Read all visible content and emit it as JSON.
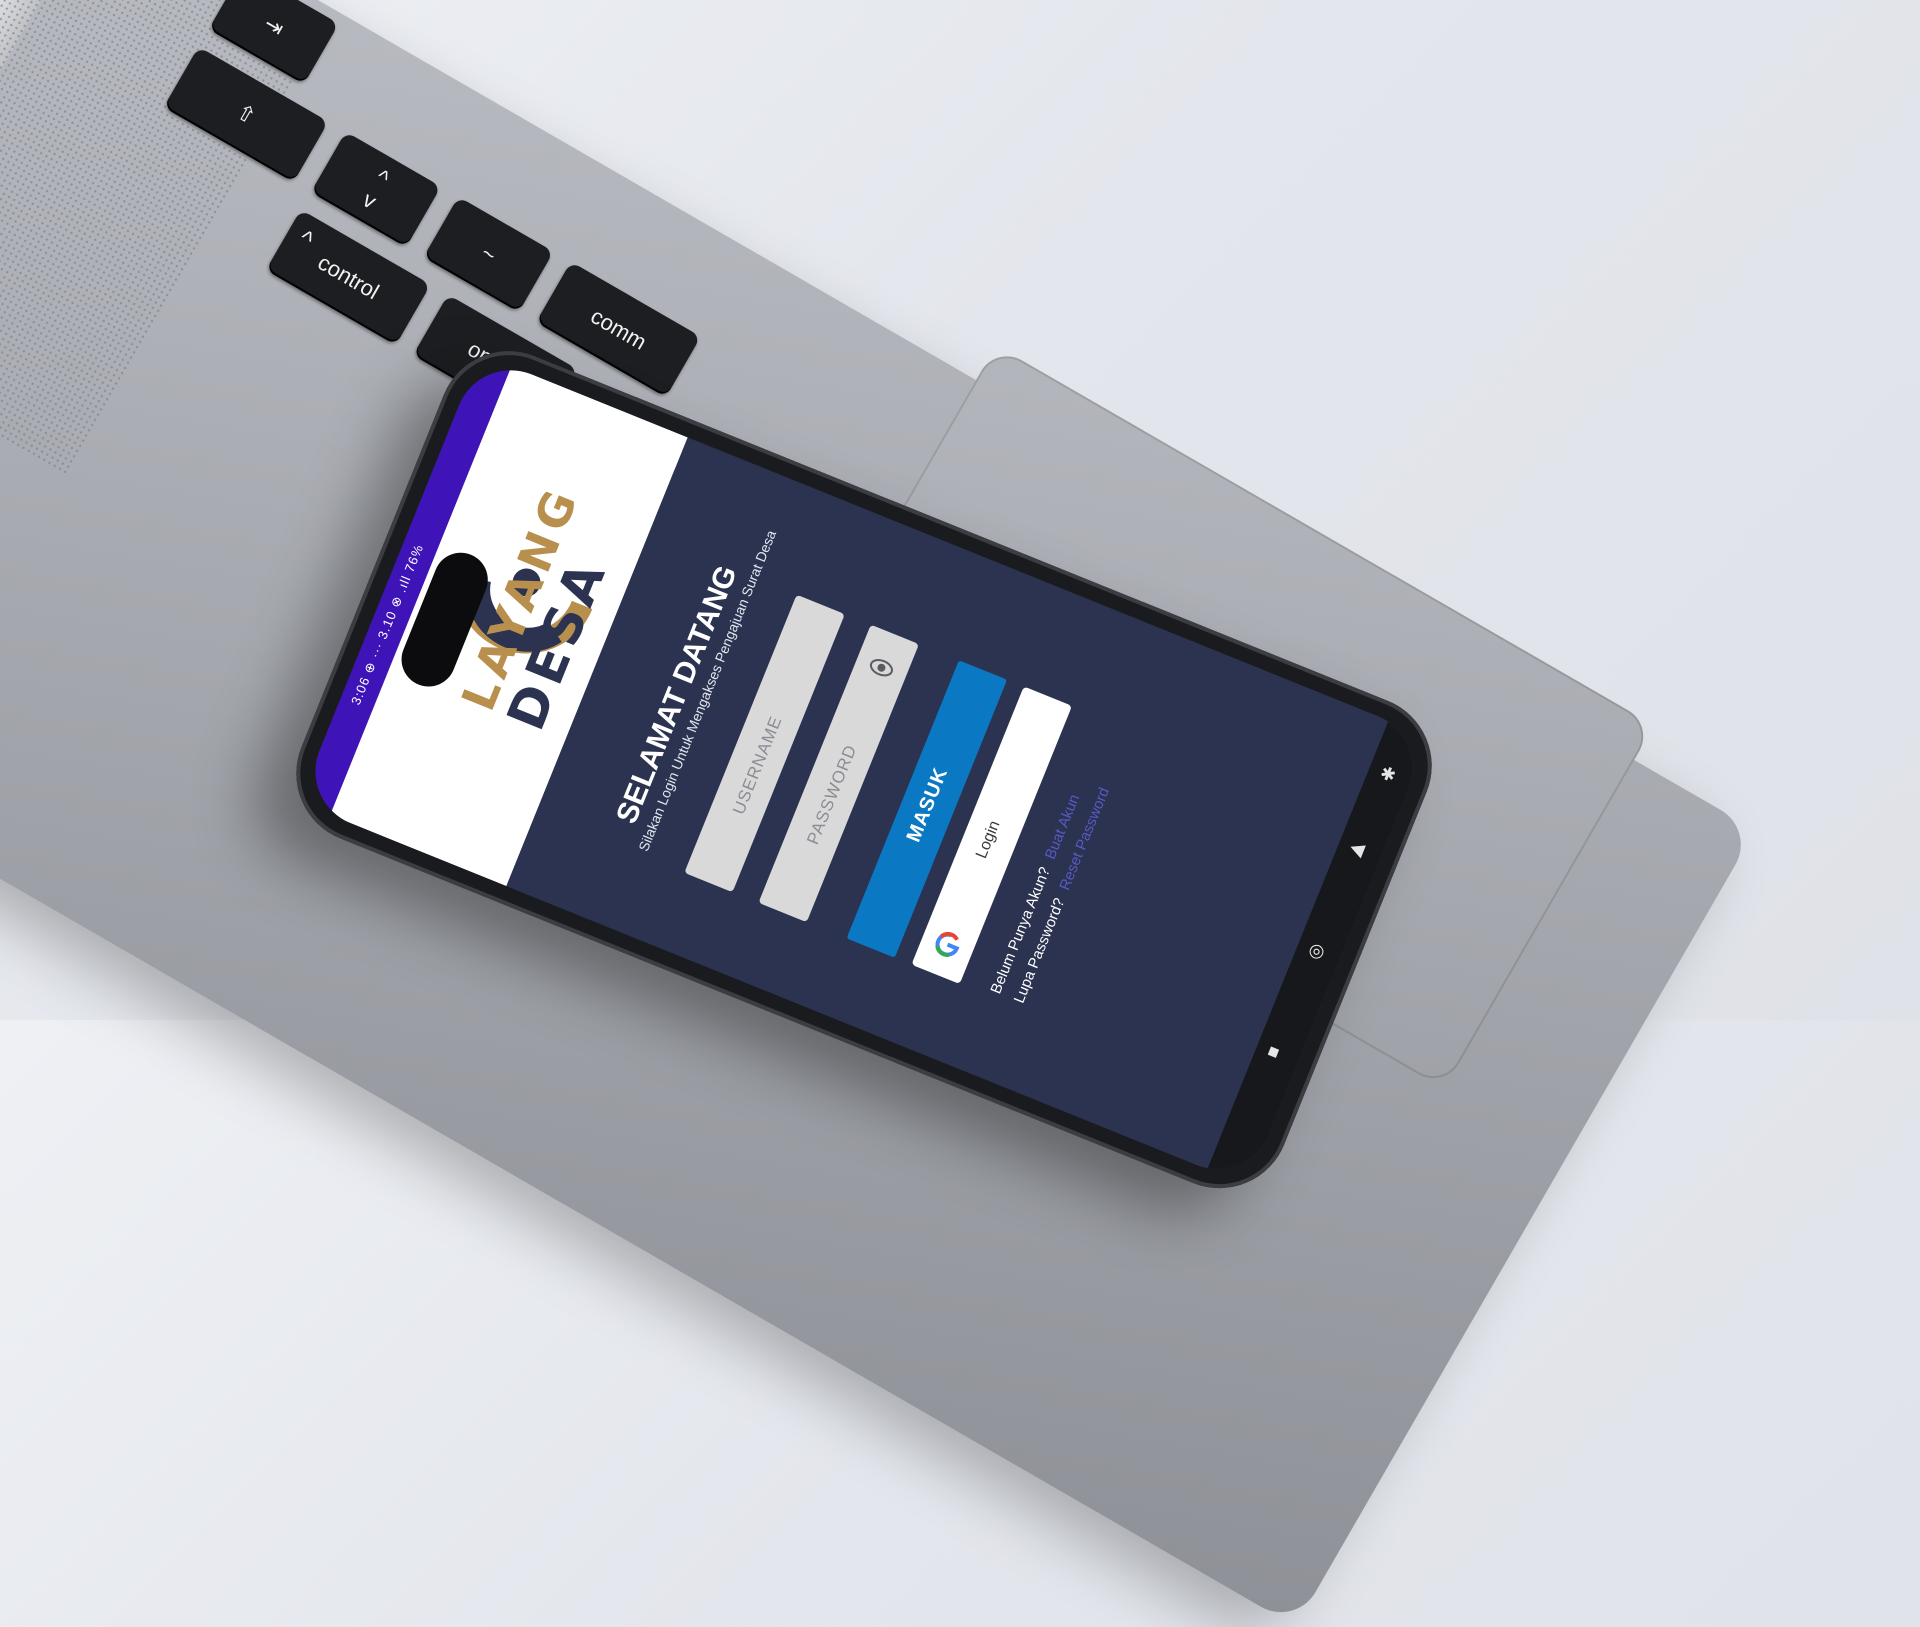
{
  "laptop": {
    "keys": {
      "command": "comm",
      "option": "option",
      "control": "control",
      "shift_symbol": "⇧",
      "tab_symbol": "⇥",
      "arrow_up": "^",
      "arrow_down": "v",
      "caret": "^",
      "tilde": "~"
    }
  },
  "phone": {
    "statusbar": {
      "text": "3:06 ⊕ ··· 3.10 ⊗ .ıll 76%"
    },
    "brand": {
      "line1": "LAYANG",
      "line2": "DESA",
      "colors": {
        "gold": "#b98f4d",
        "navy": "#2b3350"
      }
    },
    "login": {
      "title": "SELAMAT DATANG",
      "subtitle": "Silakan Login Untuk Mengakses Pengajuan Surat Desa",
      "username_placeholder": "USERNAME",
      "password_placeholder": "PASSWORD",
      "submit_label": "MASUK",
      "google_label": "Login",
      "signup_prompt": "Belum Punya Akun?",
      "signup_link": "Buat Akun",
      "forgot_prompt": "Lupa Password?",
      "forgot_link": "Reset Password"
    },
    "navbar": {
      "icons": [
        "accessibility-icon",
        "back-icon",
        "home-icon",
        "recents-icon"
      ]
    },
    "colors": {
      "statusbar": "#3e13b8",
      "panel": "#2b3350",
      "button": "#0a78c2"
    }
  }
}
